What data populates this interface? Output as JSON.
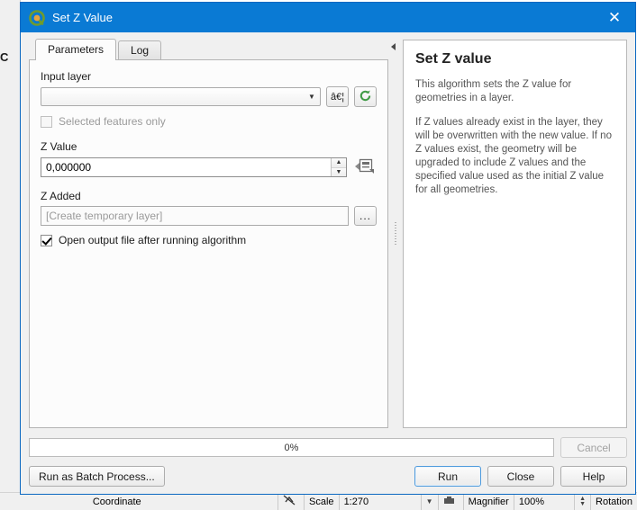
{
  "background": {
    "left_label": "C",
    "status_bar": {
      "coordinate_label": "Coordinate",
      "coordinate_value": "",
      "scale_lock_icon": "scale-lock-icon",
      "scale_label": "Scale",
      "scale_value": "1:270",
      "scale_dropdown_icon": "chevron-down-icon",
      "magnifier_icon": "magnifier-icon",
      "magnifier_label": "Magnifier",
      "magnifier_value": "100%",
      "magnifier_spinner_icon": "spinner-icon",
      "rotation_label": "Rotation"
    }
  },
  "dialog": {
    "title": "Set Z Value",
    "title_icon": "qgis-logo-icon",
    "close_icon": "close-icon",
    "tabs": [
      {
        "label": "Parameters",
        "active": true
      },
      {
        "label": "Log",
        "active": false
      }
    ],
    "parameters": {
      "input_layer": {
        "label": "Input layer",
        "value": "",
        "dropdown_icon": "chevron-down-icon",
        "select_button_label": "â€¦",
        "select_button_icon": "ellipsis-button-icon",
        "iterate_button_icon": "iterate-refresh-icon"
      },
      "selected_features_only": {
        "label": "Selected features only",
        "checked": false,
        "enabled": false
      },
      "z_value": {
        "label": "Z Value",
        "value": "0,000000",
        "spin_up_icon": "chevron-up-icon",
        "spin_down_icon": "chevron-down-icon",
        "override_icon": "data-defined-override-icon"
      },
      "z_added": {
        "label": "Z Added",
        "placeholder": "[Create temporary layer]",
        "browse_button_label": "...",
        "browse_button_icon": "browse-ellipsis-icon"
      },
      "open_output": {
        "label": "Open output file after running algorithm",
        "checked": true
      }
    },
    "splitter": {
      "collapse_icon": "collapse-left-arrow-icon",
      "grip_icon": "splitter-grip-icon"
    },
    "help": {
      "title": "Set Z value",
      "paragraphs": [
        "This algorithm sets the Z value for geometries in a layer.",
        "If Z values already exist in the layer, they will be overwritten with the new value. If no Z values exist, the geometry will be upgraded to include Z values and the specified value used as the initial Z value for all geometries."
      ]
    },
    "footer": {
      "progress_text": "0%",
      "progress_percent": 0,
      "cancel_label": "Cancel",
      "cancel_enabled": false,
      "batch_label": "Run as Batch Process...",
      "run_label": "Run",
      "close_label": "Close",
      "help_label": "Help"
    }
  },
  "colors": {
    "titlebar": "#0a7ad4",
    "accent": "#4f9bdd",
    "qgis_green": "#6f9b2e",
    "iterate_green": "#3f9b45",
    "dialog_bg": "#f0f0f0"
  }
}
